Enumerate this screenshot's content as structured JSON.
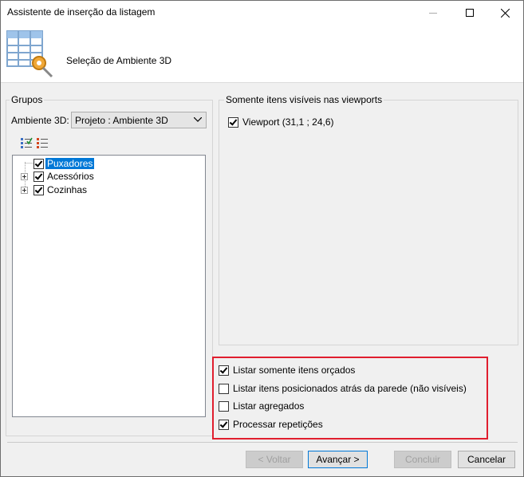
{
  "window": {
    "title": "Assistente de inserção da listagem",
    "controls": {
      "minimize": "minimize-icon",
      "maximize": "maximize-icon",
      "close": "close-icon"
    }
  },
  "header": {
    "title": "Seleção de Ambiente 3D",
    "icon": "table-gear-icon"
  },
  "groups": {
    "caption": "Grupos",
    "ambiente_label": "Ambiente 3D:",
    "ambiente_value": "Projeto : Ambiente 3D",
    "toolbar": [
      "check-all-icon",
      "uncheck-all-icon"
    ],
    "tree": [
      {
        "label": "Puxadores",
        "checked": true,
        "expandable": false,
        "selected": true
      },
      {
        "label": "Acessórios",
        "checked": true,
        "expandable": true,
        "selected": false
      },
      {
        "label": "Cozinhas",
        "checked": true,
        "expandable": true,
        "selected": false
      }
    ]
  },
  "viewports": {
    "caption": "Somente itens visíveis nas viewports",
    "items": [
      {
        "label": "Viewport (31,1 ; 24,6)",
        "checked": true
      }
    ]
  },
  "options": [
    {
      "label": "Listar somente itens orçados",
      "checked": true
    },
    {
      "label": "Listar itens posicionados atrás da parede (não visíveis)",
      "checked": false
    },
    {
      "label": "Listar agregados",
      "checked": false
    },
    {
      "label": "Processar repetições",
      "checked": true
    }
  ],
  "buttons": {
    "back": "< Voltar",
    "next": "Avançar >",
    "finish": "Concluir",
    "cancel": "Cancelar"
  },
  "highlight_color": "#e01e2e",
  "selection_color": "#0078d7"
}
